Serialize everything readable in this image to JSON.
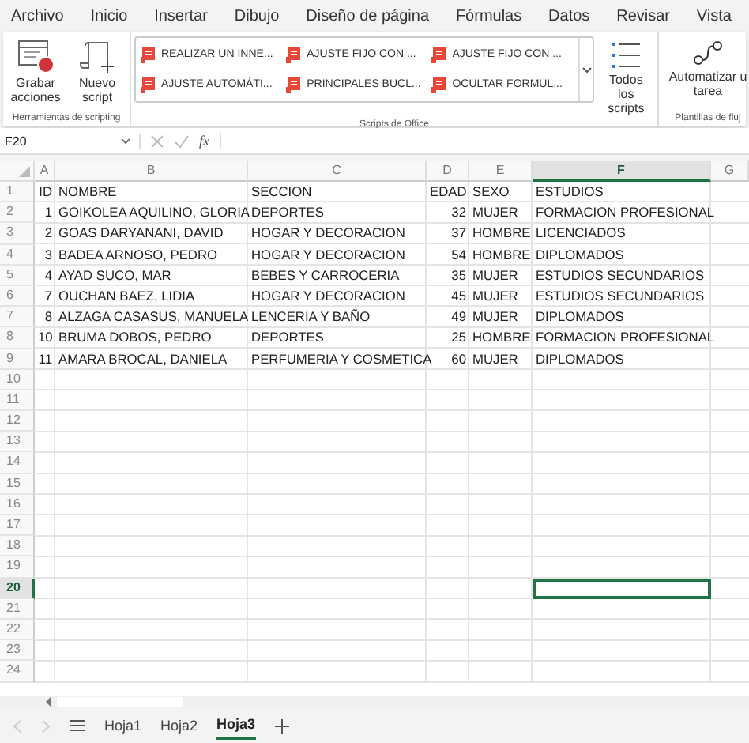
{
  "menu_tabs": [
    {
      "label": "Archivo"
    },
    {
      "label": "Inicio"
    },
    {
      "label": "Insertar"
    },
    {
      "label": "Dibujo"
    },
    {
      "label": "Diseño de página"
    },
    {
      "label": "Fórmulas"
    },
    {
      "label": "Datos"
    },
    {
      "label": "Revisar"
    },
    {
      "label": "Vista"
    }
  ],
  "ribbon": {
    "scripting_group": {
      "label": "Herramientas de scripting",
      "buttons": [
        {
          "kind": "record",
          "label": "Grabar acciones"
        },
        {
          "kind": "new",
          "label": "Nuevo script"
        }
      ]
    },
    "scripts_group": {
      "label": "Scripts de Office",
      "scripts": [
        {
          "label": "REALIZAR UN INNE..."
        },
        {
          "label": "AJUSTE AUTOMÁTI..."
        },
        {
          "label": "AJUSTE FIJO CON ..."
        },
        {
          "label": "PRINCIPALES BUCL..."
        },
        {
          "label": "AJUSTE FIJO CON ..."
        },
        {
          "label": "OCULTAR FORMUL..."
        }
      ],
      "all_button": "Todos los scripts"
    },
    "flow_group": {
      "label": "Plantillas de fluj",
      "button": "Automatizar u tarea"
    }
  },
  "formula_bar": {
    "name_box": "F20",
    "fx": "fx"
  },
  "columns": [
    {
      "label": "A",
      "selected": false
    },
    {
      "label": "B",
      "selected": false
    },
    {
      "label": "C",
      "selected": false
    },
    {
      "label": "D",
      "selected": false
    },
    {
      "label": "E",
      "selected": false
    },
    {
      "label": "F",
      "selected": true
    },
    {
      "label": "G",
      "selected": false
    }
  ],
  "rows": [
    {
      "number": "1",
      "selected": false,
      "cells": [
        "ID",
        "NOMBRE",
        "SECCION",
        "EDAD",
        "SEXO",
        "ESTUDIOS"
      ]
    },
    {
      "number": "2",
      "selected": false,
      "cells": [
        "1",
        "GOIKOLEA AQUILINO, GLORIA",
        "DEPORTES",
        "32",
        "MUJER",
        "FORMACION PROFESIONAL"
      ]
    },
    {
      "number": "3",
      "selected": false,
      "cells": [
        "2",
        "GOAS DARYANANI, DAVID",
        "HOGAR Y DECORACION",
        "37",
        "HOMBRE",
        "LICENCIADOS"
      ]
    },
    {
      "number": "4",
      "selected": false,
      "cells": [
        "3",
        "BADEA ARNOSO, PEDRO",
        "HOGAR Y DECORACION",
        "54",
        "HOMBRE",
        "DIPLOMADOS"
      ]
    },
    {
      "number": "5",
      "selected": false,
      "cells": [
        "4",
        "AYAD SUCO, MAR",
        "BEBES Y CARROCERIA",
        "35",
        "MUJER",
        "ESTUDIOS SECUNDARIOS"
      ]
    },
    {
      "number": "6",
      "selected": false,
      "cells": [
        "7",
        "OUCHAN BAEZ, LIDIA",
        "HOGAR Y DECORACION",
        "45",
        "MUJER",
        "ESTUDIOS SECUNDARIOS"
      ]
    },
    {
      "number": "7",
      "selected": false,
      "cells": [
        "8",
        "ALZAGA CASASUS, MANUELA",
        "LENCERIA Y BAÑO",
        "49",
        "MUJER",
        "DIPLOMADOS"
      ]
    },
    {
      "number": "8",
      "selected": false,
      "cells": [
        "10",
        "BRUMA DOBOS, PEDRO",
        "DEPORTES",
        "25",
        "HOMBRE",
        "FORMACION PROFESIONAL"
      ]
    },
    {
      "number": "9",
      "selected": false,
      "cells": [
        "11",
        "AMARA BROCAL, DANIELA",
        "PERFUMERIA Y COSMETICA",
        "60",
        "MUJER",
        "DIPLOMADOS"
      ]
    },
    {
      "number": "10",
      "selected": false
    },
    {
      "number": "11",
      "selected": false
    },
    {
      "number": "12",
      "selected": false
    },
    {
      "number": "13",
      "selected": false
    },
    {
      "number": "14",
      "selected": false
    },
    {
      "number": "15",
      "selected": false
    },
    {
      "number": "16",
      "selected": false
    },
    {
      "number": "17",
      "selected": false
    },
    {
      "number": "18",
      "selected": false
    },
    {
      "number": "19",
      "selected": false
    },
    {
      "number": "20",
      "selected": true
    },
    {
      "number": "21",
      "selected": false
    },
    {
      "number": "22",
      "selected": false
    },
    {
      "number": "23",
      "selected": false
    },
    {
      "number": "24",
      "selected": false
    }
  ],
  "sheet_tabs": [
    {
      "label": "Hoja1",
      "selected": false
    },
    {
      "label": "Hoja2",
      "selected": false
    },
    {
      "label": "Hoja3",
      "selected": true
    }
  ]
}
